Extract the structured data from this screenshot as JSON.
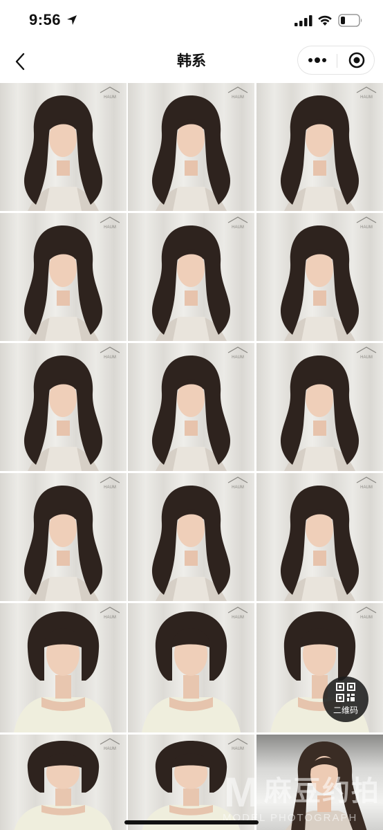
{
  "status_bar": {
    "time": "9:56",
    "icons": [
      "location-arrow-icon",
      "cellular-signal-icon",
      "wifi-icon",
      "battery-icon"
    ]
  },
  "nav": {
    "back_icon": "chevron-left-icon",
    "title": "韩系",
    "more_icon": "more-dots-icon",
    "close_icon": "target-close-icon"
  },
  "gallery": {
    "logo_text": "HAUM",
    "rows": [
      [
        {
          "hair": "long-wavy"
        },
        {
          "hair": "long-wavy"
        },
        {
          "hair": "long-wavy"
        }
      ],
      [
        {
          "hair": "long-wavy"
        },
        {
          "hair": "long-wavy"
        },
        {
          "hair": "long-wavy"
        }
      ],
      [
        {
          "hair": "long-wavy"
        },
        {
          "hair": "long-wavy"
        },
        {
          "hair": "long-wavy"
        }
      ],
      [
        {
          "hair": "long-wavy"
        },
        {
          "hair": "long-wavy"
        },
        {
          "hair": "long-wavy"
        }
      ],
      [
        {
          "hair": "bob-bangs"
        },
        {
          "hair": "bob-bangs"
        },
        {
          "hair": "bob-bangs"
        }
      ],
      [
        {
          "hair": "bob-bangs"
        },
        {
          "hair": "bob-bangs"
        },
        {
          "hair": "long-side"
        }
      ]
    ]
  },
  "qr_button": {
    "label": "二维码",
    "icon": "qr-code-icon"
  },
  "watermark": {
    "letter": "M",
    "chinese": "麻豆约拍",
    "english": "MODEL PHOTOGRAPH"
  },
  "colors": {
    "hair": "#2e231e",
    "background": "#ffffff",
    "qr_bg": "#1c1c1c"
  }
}
